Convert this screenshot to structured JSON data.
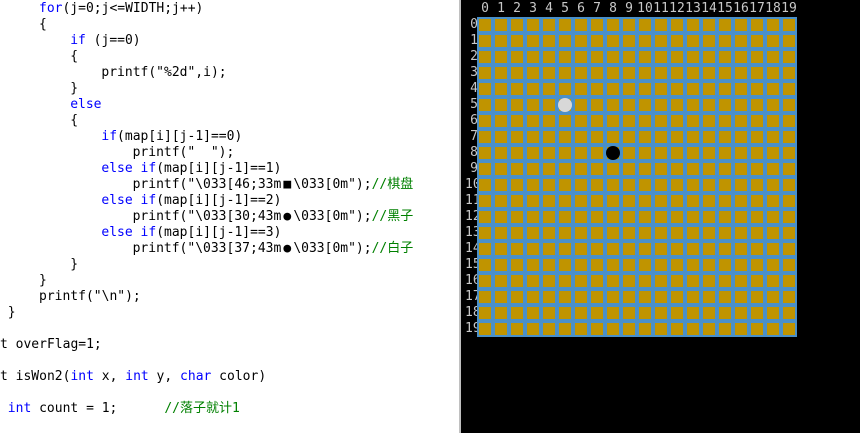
{
  "editor": {
    "lines": [
      {
        "indent": 5,
        "tokens": [
          {
            "t": "for",
            "c": "kw"
          },
          {
            "t": "(j=0;j<=WIDTH;j++)"
          }
        ]
      },
      {
        "indent": 5,
        "tokens": [
          {
            "t": "{"
          }
        ]
      },
      {
        "indent": 9,
        "tokens": [
          {
            "t": "if",
            "c": "kw"
          },
          {
            "t": " (j==0)"
          }
        ]
      },
      {
        "indent": 9,
        "tokens": [
          {
            "t": "{"
          }
        ]
      },
      {
        "indent": 13,
        "tokens": [
          {
            "t": "printf(\"%2d\",i);"
          }
        ]
      },
      {
        "indent": 9,
        "tokens": [
          {
            "t": "}"
          }
        ]
      },
      {
        "indent": 9,
        "tokens": [
          {
            "t": "else",
            "c": "kw"
          }
        ]
      },
      {
        "indent": 9,
        "tokens": [
          {
            "t": "{"
          }
        ]
      },
      {
        "indent": 13,
        "tokens": [
          {
            "t": "if",
            "c": "kw"
          },
          {
            "t": "(map[i][j-1]==0)"
          }
        ]
      },
      {
        "indent": 17,
        "tokens": [
          {
            "t": "printf(\"  \");"
          }
        ]
      },
      {
        "indent": 13,
        "tokens": [
          {
            "t": "else",
            "c": "kw"
          },
          {
            "t": " "
          },
          {
            "t": "if",
            "c": "kw"
          },
          {
            "t": "(map[i][j-1]==1)"
          }
        ]
      },
      {
        "indent": 17,
        "tokens": [
          {
            "t": "printf(\"\\033[46;33m"
          },
          {
            "t": "■",
            "c": "sym"
          },
          {
            "t": "\\033[0m\");"
          },
          {
            "t": "//棋盘",
            "c": "cm"
          }
        ]
      },
      {
        "indent": 13,
        "tokens": [
          {
            "t": "else",
            "c": "kw"
          },
          {
            "t": " "
          },
          {
            "t": "if",
            "c": "kw"
          },
          {
            "t": "(map[i][j-1]==2)"
          }
        ]
      },
      {
        "indent": 17,
        "tokens": [
          {
            "t": "printf(\"\\033[30;43m"
          },
          {
            "t": "●",
            "c": "sym"
          },
          {
            "t": "\\033[0m\");"
          },
          {
            "t": "//黑子",
            "c": "cm"
          }
        ]
      },
      {
        "indent": 13,
        "tokens": [
          {
            "t": "else",
            "c": "kw"
          },
          {
            "t": " "
          },
          {
            "t": "if",
            "c": "kw"
          },
          {
            "t": "(map[i][j-1]==3)"
          }
        ]
      },
      {
        "indent": 17,
        "tokens": [
          {
            "t": "printf(\"\\033[37;43m"
          },
          {
            "t": "●",
            "c": "sym"
          },
          {
            "t": "\\033[0m\");"
          },
          {
            "t": "//白子",
            "c": "cm"
          }
        ]
      },
      {
        "indent": 9,
        "tokens": [
          {
            "t": "}"
          }
        ]
      },
      {
        "indent": 5,
        "tokens": [
          {
            "t": "}"
          }
        ]
      },
      {
        "indent": 5,
        "tokens": [
          {
            "t": "printf(\"\\n\");"
          }
        ]
      },
      {
        "indent": 1,
        "tokens": [
          {
            "t": "}"
          }
        ]
      },
      {
        "indent": 0,
        "tokens": []
      },
      {
        "indent": 0,
        "tokens": [
          {
            "t": "t overFlag=1;"
          }
        ]
      },
      {
        "indent": 0,
        "tokens": []
      },
      {
        "indent": 0,
        "tokens": [
          {
            "t": "t isWon2("
          },
          {
            "t": "int",
            "c": "kw"
          },
          {
            "t": " x, "
          },
          {
            "t": "int",
            "c": "kw"
          },
          {
            "t": " y, "
          },
          {
            "t": "char",
            "c": "kw"
          },
          {
            "t": " color)"
          }
        ]
      },
      {
        "indent": 0,
        "tokens": []
      },
      {
        "indent": 1,
        "tokens": [
          {
            "t": "int",
            "c": "kw"
          },
          {
            "t": " count = 1;      "
          },
          {
            "t": "//落子就计1",
            "c": "cm"
          }
        ]
      }
    ]
  },
  "console": {
    "col_headers": [
      "0",
      "1",
      "2",
      "3",
      "4",
      "5",
      "6",
      "7",
      "8",
      "9",
      "10",
      "11",
      "12",
      "13",
      "14",
      "15",
      "16",
      "17",
      "18",
      "19"
    ],
    "row_headers": [
      "0",
      "1",
      "2",
      "3",
      "4",
      "5",
      "6",
      "7",
      "8",
      "9",
      "10",
      "11",
      "12",
      "13",
      "14",
      "15",
      "16",
      "17",
      "18",
      "19"
    ],
    "board": {
      "size": 20,
      "grid_color": "#4a90c8",
      "cell_color": "#c09400",
      "stones": [
        {
          "row": 5,
          "col": 5,
          "color": "white"
        },
        {
          "row": 8,
          "col": 8,
          "color": "black"
        }
      ]
    }
  },
  "colors": {
    "editor_background": "#ffffff",
    "keyword": "#0000ff",
    "comment": "#008000",
    "console_background": "#000000",
    "console_text": "#c8c8c8"
  }
}
